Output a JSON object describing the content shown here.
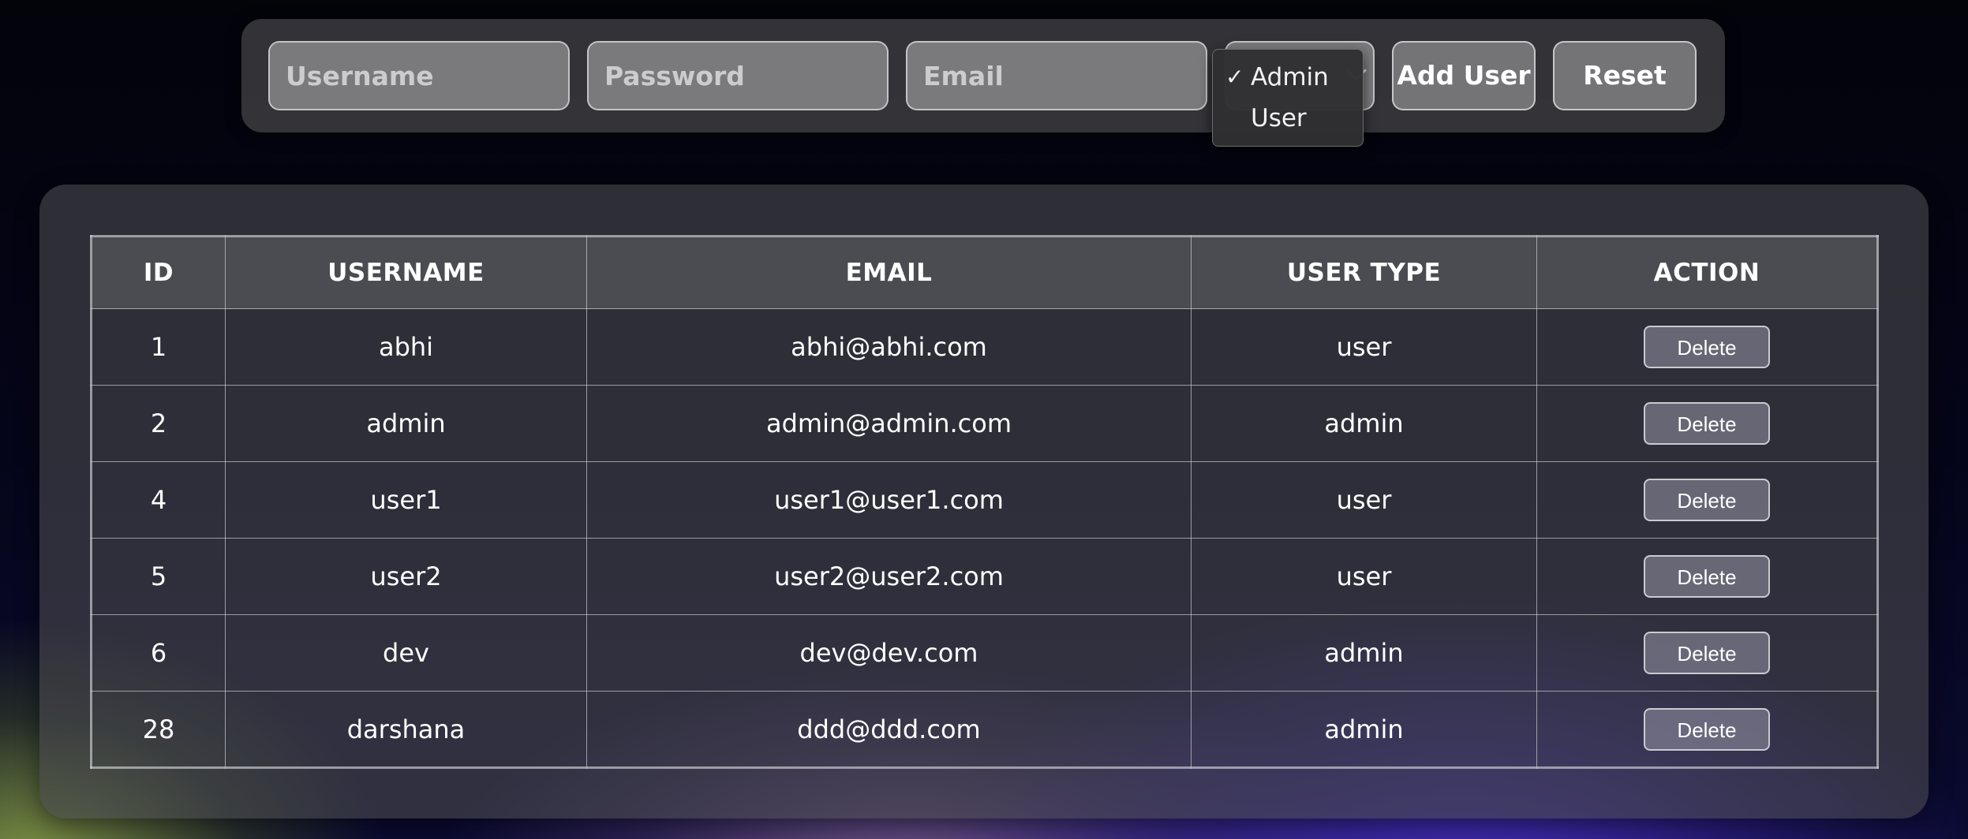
{
  "form": {
    "username_placeholder": "Username",
    "password_placeholder": "Password",
    "email_placeholder": "Email",
    "user_type_select": {
      "options": [
        "Admin",
        "User"
      ],
      "selected": "Admin",
      "check_glyph": "✓"
    },
    "add_user_label": "Add User",
    "reset_label": "Reset"
  },
  "table": {
    "headers": [
      "ID",
      "USERNAME",
      "EMAIL",
      "USER TYPE",
      "ACTION"
    ],
    "rows": [
      {
        "id": "1",
        "username": "abhi",
        "email": "abhi@abhi.com",
        "user_type": "user",
        "action_label": "Delete"
      },
      {
        "id": "2",
        "username": "admin",
        "email": "admin@admin.com",
        "user_type": "admin",
        "action_label": "Delete"
      },
      {
        "id": "4",
        "username": "user1",
        "email": "user1@user1.com",
        "user_type": "user",
        "action_label": "Delete"
      },
      {
        "id": "5",
        "username": "user2",
        "email": "user2@user2.com",
        "user_type": "user",
        "action_label": "Delete"
      },
      {
        "id": "6",
        "username": "dev",
        "email": "dev@dev.com",
        "user_type": "admin",
        "action_label": "Delete"
      },
      {
        "id": "28",
        "username": "darshana",
        "email": "ddd@ddd.com",
        "user_type": "admin",
        "action_label": "Delete"
      }
    ]
  },
  "colors": {
    "panel_bg": "#3c3c40",
    "field_bg": "#808082",
    "accent_purple": "#4e34d2",
    "accent_green": "#96af46"
  }
}
